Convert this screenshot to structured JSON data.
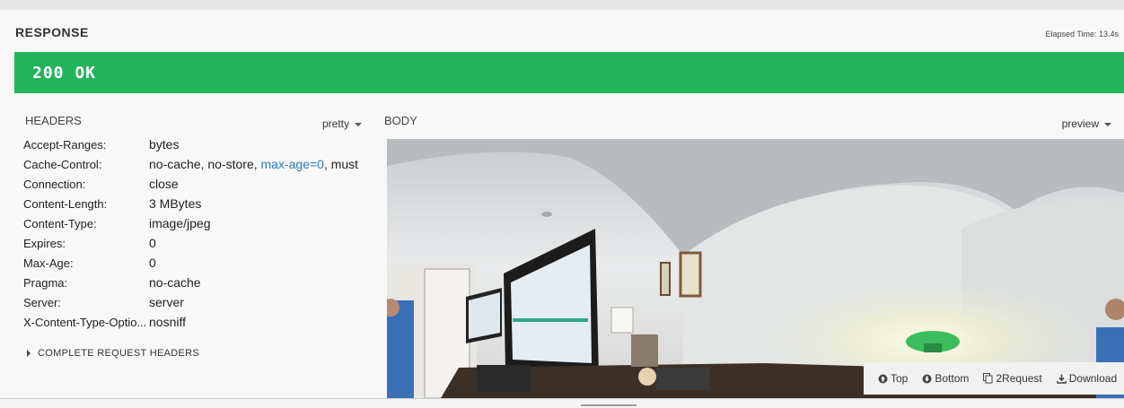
{
  "response": {
    "title": "RESPONSE",
    "elapsed": "Elapsed Time: 13.4s",
    "status": "200 OK",
    "status_color": "#22b45a"
  },
  "headers_panel": {
    "title": "HEADERS",
    "format_select": "pretty",
    "rows": [
      {
        "name": "Accept-Ranges:",
        "value": "bytes"
      },
      {
        "name": "Cache-Control:",
        "value_pre": "no-cache, no-store, ",
        "value_link": "max-age=0",
        "value_post": ", must"
      },
      {
        "name": "Connection:",
        "value": "close"
      },
      {
        "name": "Content-Length:",
        "value": "3 MBytes"
      },
      {
        "name": "Content-Type:",
        "value": "image/jpeg"
      },
      {
        "name": "Expires:",
        "value": "0"
      },
      {
        "name": "Max-Age:",
        "value": "0"
      },
      {
        "name": "Pragma:",
        "value": "no-cache"
      },
      {
        "name": "Server:",
        "value": "server"
      },
      {
        "name": "X-Content-Type-Optio...",
        "value": "nosniff"
      }
    ],
    "complete_label": "COMPLETE REQUEST HEADERS"
  },
  "body_panel": {
    "title": "BODY",
    "format_select": "preview"
  },
  "toolbar": {
    "top": "Top",
    "bottom": "Bottom",
    "request": "2Request",
    "download": "Download"
  },
  "link_color": "#2a7bbd"
}
